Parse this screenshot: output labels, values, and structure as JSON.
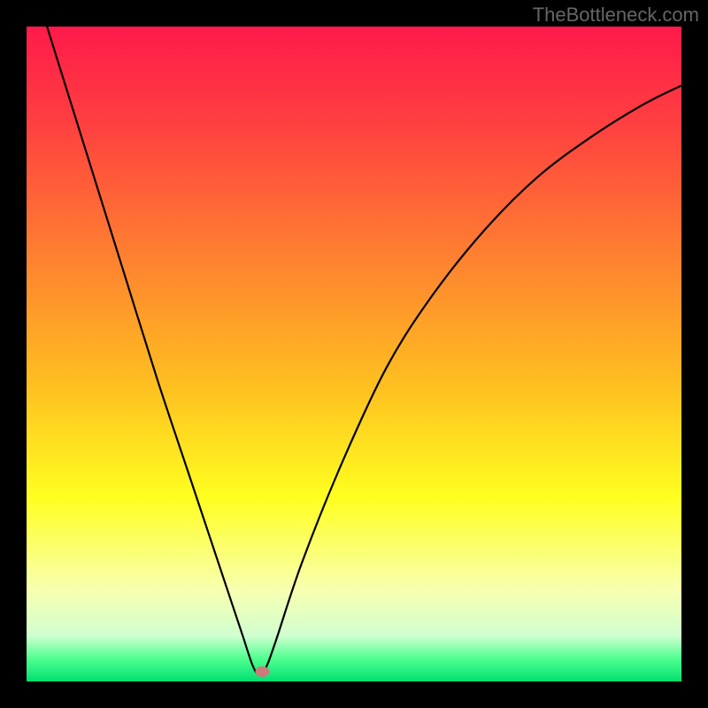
{
  "watermark": "TheBottleneck.com",
  "chart_data": {
    "type": "line",
    "title": "",
    "xlabel": "",
    "ylabel": "",
    "xlim": [
      0,
      100
    ],
    "ylim": [
      0,
      100
    ],
    "background_gradient": {
      "stops": [
        {
          "offset": 0.0,
          "color": "#ff1a4a"
        },
        {
          "offset": 0.15,
          "color": "#ff4040"
        },
        {
          "offset": 0.35,
          "color": "#ff8030"
        },
        {
          "offset": 0.55,
          "color": "#ffc020"
        },
        {
          "offset": 0.72,
          "color": "#ffff20"
        },
        {
          "offset": 0.86,
          "color": "#f8ffb0"
        },
        {
          "offset": 0.93,
          "color": "#d0ffd0"
        },
        {
          "offset": 0.965,
          "color": "#50ff90"
        },
        {
          "offset": 1.0,
          "color": "#00e070"
        }
      ]
    },
    "series": [
      {
        "name": "bottleneck-curve",
        "x": [
          0,
          5,
          10,
          15,
          20,
          25,
          28,
          31,
          33,
          34.5,
          35.5,
          36.5,
          38,
          42,
          48,
          55,
          62,
          70,
          78,
          86,
          94,
          100
        ],
        "y": [
          110,
          94,
          78,
          62,
          46,
          31,
          22,
          13,
          7,
          2.5,
          1,
          2,
          6,
          18,
          33,
          48,
          59,
          69,
          77,
          83,
          88,
          91
        ]
      }
    ],
    "marker": {
      "x": 36,
      "y": 1.5,
      "color": "#cc7a7a",
      "rx": 8,
      "ry": 6
    }
  }
}
